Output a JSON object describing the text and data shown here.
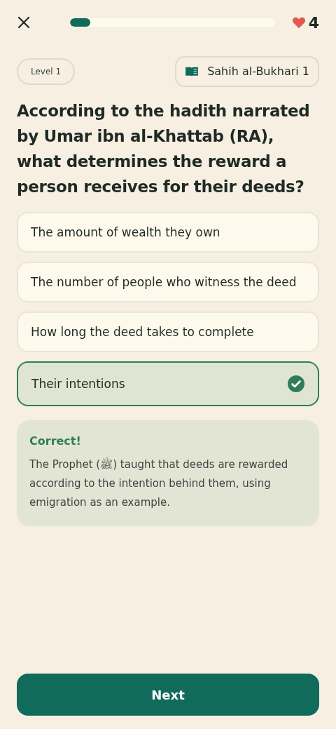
{
  "header": {
    "progress": {
      "level": 0.1
    },
    "lives": "4"
  },
  "level_badge": "Level 1",
  "source_chip": "Sahih al-Bukhari 1",
  "question": "According to the hadith narrated by Umar ibn al-Khattab (RA), what determines the reward a person receives for their deeds?",
  "options": [
    {
      "label": "The amount of wealth they own",
      "selected": false
    },
    {
      "label": "The number of people who witness the deed",
      "selected": false
    },
    {
      "label": "How long the deed takes to complete",
      "selected": false
    },
    {
      "label": "Their intentions",
      "selected": true
    }
  ],
  "feedback": {
    "title": "Correct!",
    "text": "The Prophet (ﷺ) taught that deeds are rewarded according to the intention behind them, using emigration as an example."
  },
  "next_button": "Next"
}
